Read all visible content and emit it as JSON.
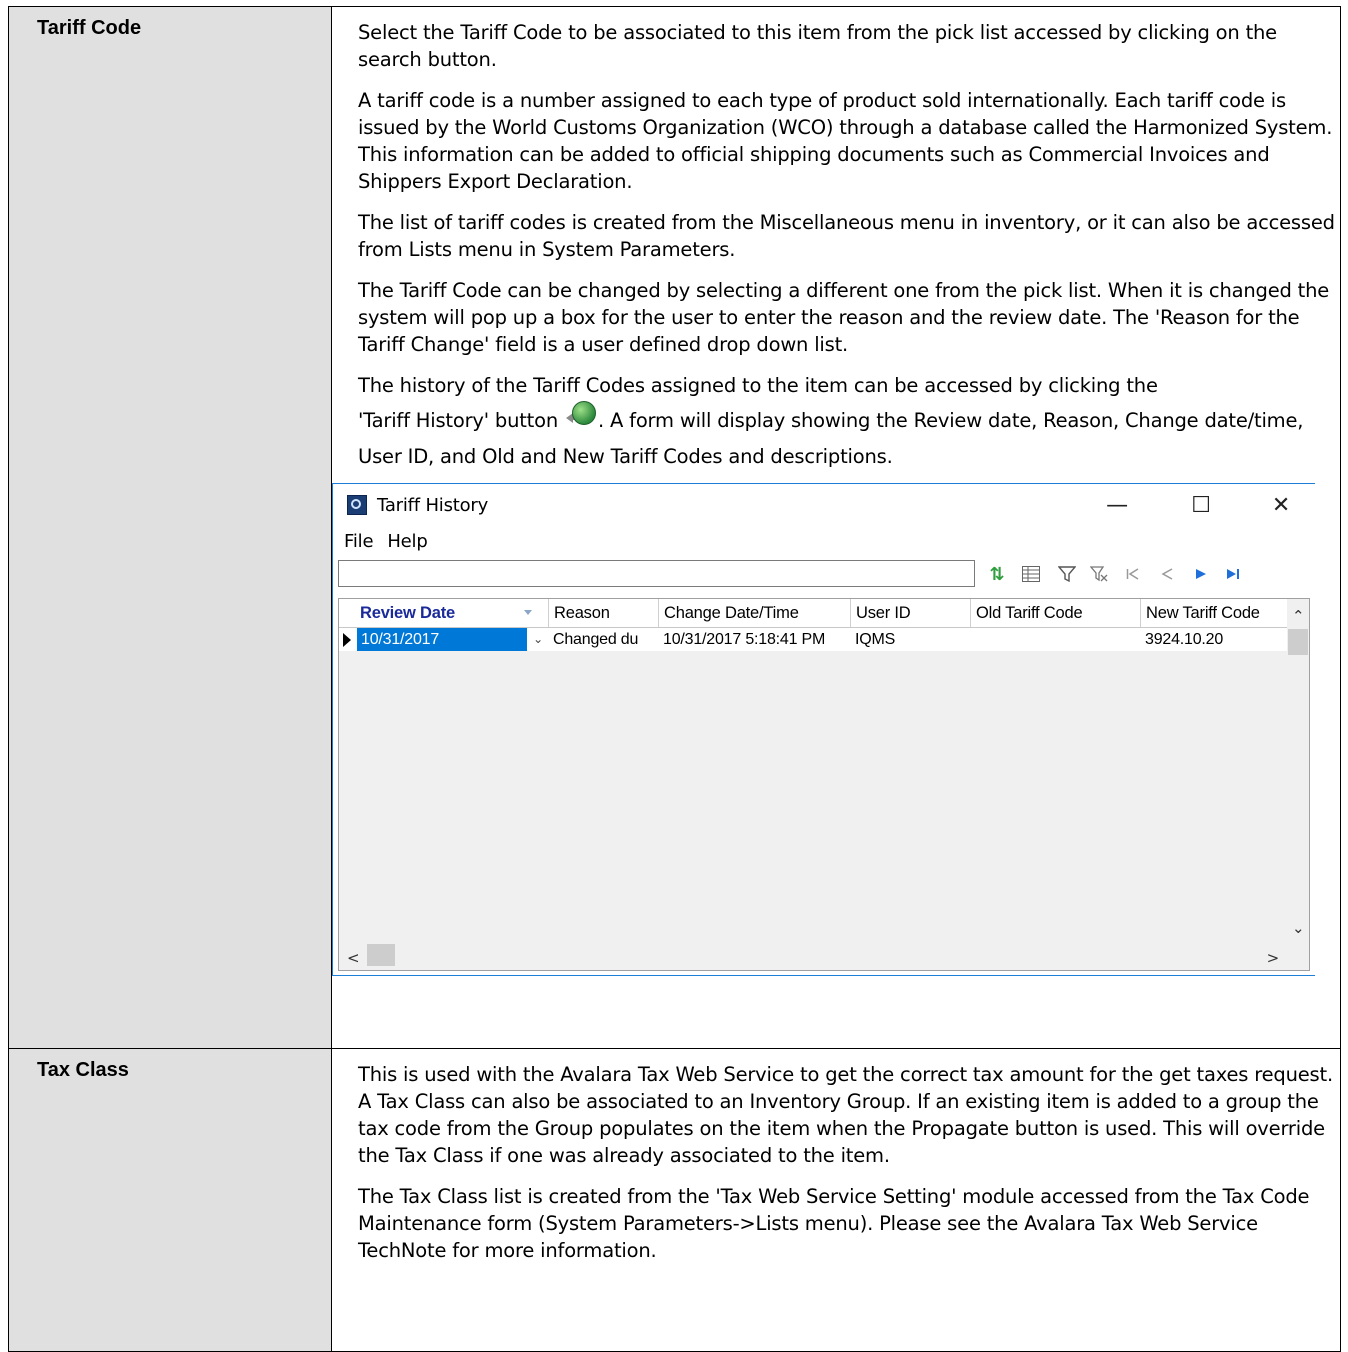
{
  "rows": [
    {
      "label": "Tariff Code",
      "paragraphs": [
        "Select the Tariff Code to be associated to this item from the pick list accessed by clicking on the search button.",
        "A tariff code is a number assigned to each type of product sold internationally. Each tariff code is issued by the World Customs Organization (WCO) through a database called the Harmonized System. This information can be added to official shipping documents such as Commercial Invoices and Shippers Export Declaration.",
        "The list of tariff codes is created from the Miscellaneous menu in inventory, or it can also be accessed from Lists menu in System Parameters.",
        "The Tariff Code can be changed by selecting a different one from the pick list. When it is changed the system will pop up a box for the user to enter the reason and the review date. The 'Reason for the Tariff Change' field is a user defined drop down list."
      ],
      "history_line_1": "The history of the Tariff Codes assigned to the item can be accessed by clicking the",
      "history_before_icon": "'Tariff History' button",
      "history_after_icon": ". A form will display showing the Review date, Reason, Change date/time, User ID, and Old and New Tariff Codes and descriptions.",
      "history_icon": "tariff-history-icon"
    },
    {
      "label": "Tax Class",
      "paragraphs": [
        "This is used with the Avalara Tax Web Service to get the correct tax amount for the get taxes request. A Tax Class can also be associated to an Inventory Group. If an existing item is added to a group the tax code from the Group populates on the item when the Propagate button is used. This will override the Tax Class if one was already associated to the item.",
        "The Tax Class list is created from the 'Tax Web Service Setting' module accessed from the Tax Code Maintenance form (System Parameters->Lists menu). Please see the Avalara Tax Web Service TechNote for more information."
      ]
    }
  ],
  "window": {
    "title": "Tariff History",
    "controls": {
      "minimize": "—",
      "maximize": "☐",
      "close": "✕"
    },
    "menu": [
      "File",
      "Help"
    ],
    "search_value": "",
    "toolbar_icons": [
      "sort-icon",
      "columns-icon",
      "filter-icon",
      "clear-filter-icon",
      "first-record-icon",
      "prior-record-icon",
      "next-record-icon",
      "last-record-icon"
    ],
    "columns": [
      "Review Date",
      "Reason",
      "Change Date/Time",
      "User ID",
      "Old Tariff Code",
      "New Tariff Code"
    ],
    "rows": [
      [
        "10/31/2017",
        "Changed du",
        "10/31/2017 5:18:41 PM",
        "IQMS",
        "",
        "3924.10.20"
      ]
    ]
  },
  "colors": {
    "label_bg": "#e0e0e0",
    "window_border": "#1e7fd8",
    "selected_cell": "#0078d7",
    "sorted_header": "#1a2a9a",
    "nav_blue": "#1e6fd9",
    "sort_green": "#2e9e3e"
  }
}
